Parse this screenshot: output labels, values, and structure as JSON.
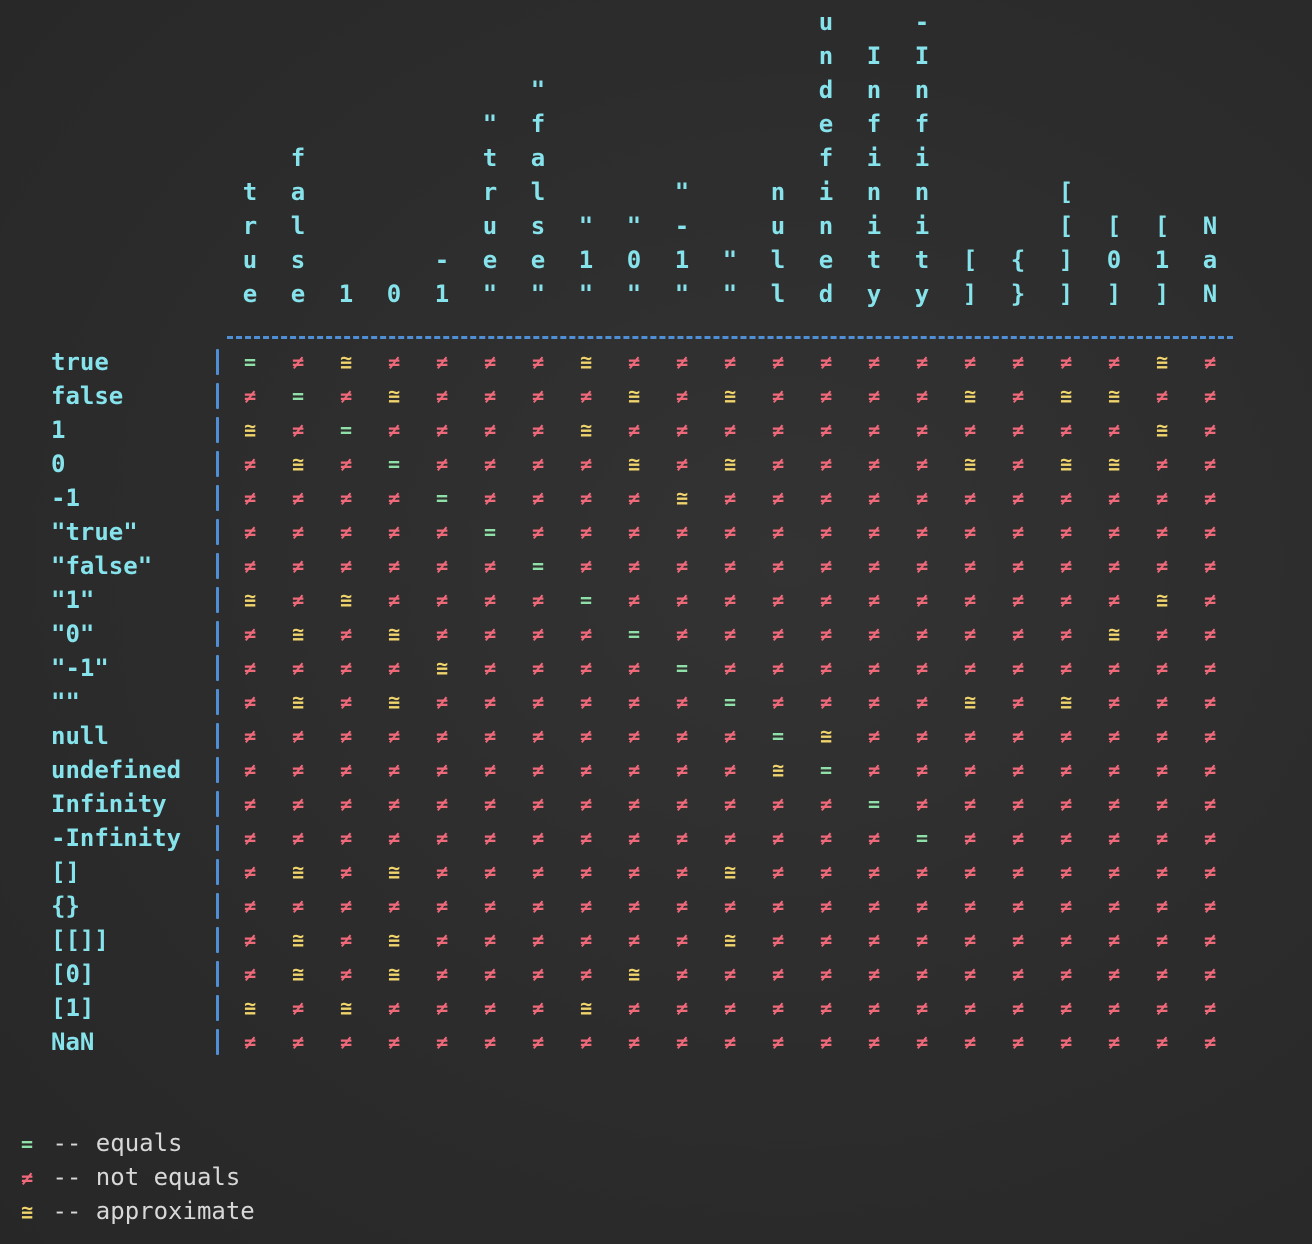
{
  "columns": [
    "true",
    "false",
    "1",
    "0",
    "-1",
    "\"true\"",
    "\"false\"",
    "\"1\"",
    "\"0\"",
    "\"-1\"",
    "\"\"",
    "null",
    "undefined",
    "Infinity",
    "-Infinity",
    "[]",
    "{}",
    "[[]]",
    "[0]",
    "[1]",
    "NaN"
  ],
  "rows": [
    {
      "label": "true",
      "cells": "=≠≅≠≠≠≠≅≠≠≠≠≠≠≠≠≠≠≠≅≠"
    },
    {
      "label": "false",
      "cells": "≠=≠≅≠≠≠≠≅≠≅≠≠≠≠≅≠≅≅≠≠"
    },
    {
      "label": "1",
      "cells": "≅≠=≠≠≠≠≅≠≠≠≠≠≠≠≠≠≠≠≅≠"
    },
    {
      "label": "0",
      "cells": "≠≅≠=≠≠≠≠≅≠≅≠≠≠≠≅≠≅≅≠≠"
    },
    {
      "label": "-1",
      "cells": "≠≠≠≠=≠≠≠≠≅≠≠≠≠≠≠≠≠≠≠≠"
    },
    {
      "label": "\"true\"",
      "cells": "≠≠≠≠≠=≠≠≠≠≠≠≠≠≠≠≠≠≠≠≠"
    },
    {
      "label": "\"false\"",
      "cells": "≠≠≠≠≠≠=≠≠≠≠≠≠≠≠≠≠≠≠≠≠"
    },
    {
      "label": "\"1\"",
      "cells": "≅≠≅≠≠≠≠=≠≠≠≠≠≠≠≠≠≠≠≅≠"
    },
    {
      "label": "\"0\"",
      "cells": "≠≅≠≅≠≠≠≠=≠≠≠≠≠≠≠≠≠≅≠≠"
    },
    {
      "label": "\"-1\"",
      "cells": "≠≠≠≠≅≠≠≠≠=≠≠≠≠≠≠≠≠≠≠≠"
    },
    {
      "label": "\"\"",
      "cells": "≠≅≠≅≠≠≠≠≠≠=≠≠≠≠≅≠≅≠≠≠"
    },
    {
      "label": "null",
      "cells": "≠≠≠≠≠≠≠≠≠≠≠=≅≠≠≠≠≠≠≠≠"
    },
    {
      "label": "undefined",
      "cells": "≠≠≠≠≠≠≠≠≠≠≠≅=≠≠≠≠≠≠≠≠"
    },
    {
      "label": "Infinity",
      "cells": "≠≠≠≠≠≠≠≠≠≠≠≠≠=≠≠≠≠≠≠≠"
    },
    {
      "label": "-Infinity",
      "cells": "≠≠≠≠≠≠≠≠≠≠≠≠≠≠=≠≠≠≠≠≠"
    },
    {
      "label": "[]",
      "cells": "≠≅≠≅≠≠≠≠≠≠≅≠≠≠≠≠≠≠≠≠≠"
    },
    {
      "label": "{}",
      "cells": "≠≠≠≠≠≠≠≠≠≠≠≠≠≠≠≠≠≠≠≠≠"
    },
    {
      "label": "[[]]",
      "cells": "≠≅≠≅≠≠≠≠≠≠≅≠≠≠≠≠≠≠≠≠≠"
    },
    {
      "label": "[0]",
      "cells": "≠≅≠≅≠≠≠≠≅≠≠≠≠≠≠≠≠≠≠≠≠"
    },
    {
      "label": "[1]",
      "cells": "≅≠≅≠≠≠≠≅≠≠≠≠≠≠≠≠≠≠≠≠≠"
    },
    {
      "label": "NaN",
      "cells": "≠≠≠≠≠≠≠≠≠≠≠≠≠≠≠≠≠≠≠≠≠"
    }
  ],
  "legend": [
    {
      "symbol": "=",
      "text": "-- equals",
      "color": "#8fe0a8"
    },
    {
      "symbol": "≠",
      "text": "-- not equals",
      "color": "#f0697a"
    },
    {
      "symbol": "≅",
      "text": "-- approximate",
      "color": "#f1d46b"
    }
  ],
  "colors": {
    "equals": "#8fe0a8",
    "not_equals": "#f0697a",
    "approximate": "#f1d46b",
    "label": "#86e3ec",
    "rule": "#4f8fd6"
  }
}
